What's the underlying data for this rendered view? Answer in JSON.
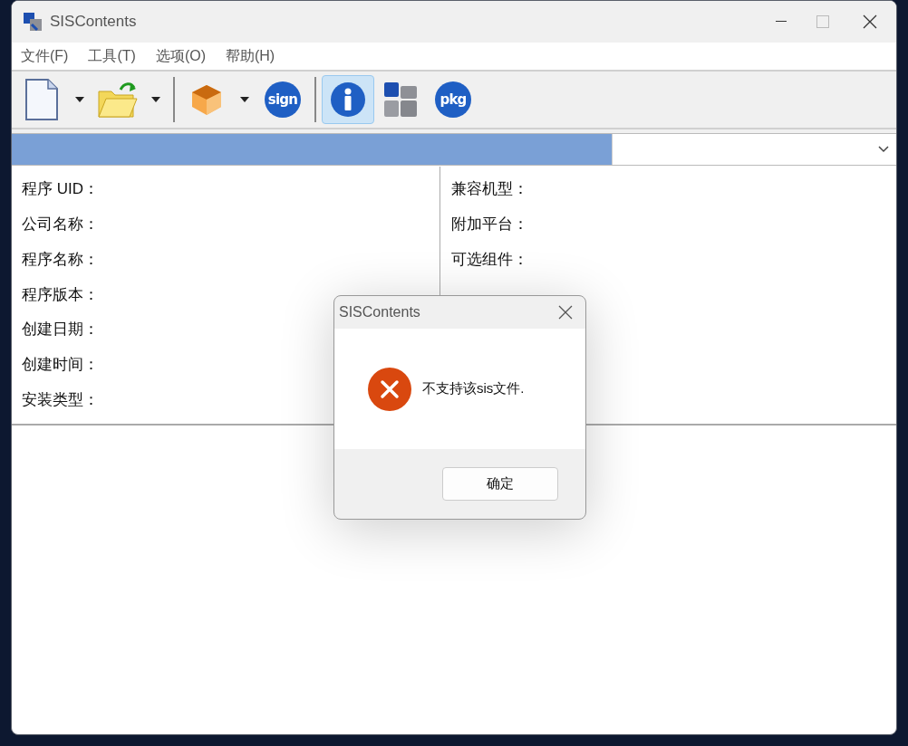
{
  "window": {
    "title": "SISContents"
  },
  "menu": [
    {
      "label": "文件(F)"
    },
    {
      "label": "工具(T)"
    },
    {
      "label": "选项(O)"
    },
    {
      "label": "帮助(H)"
    }
  ],
  "toolbar": [
    {
      "kind": "new",
      "dropdown": true,
      "selected": false
    },
    {
      "kind": "open",
      "dropdown": true,
      "selected": false
    },
    {
      "kind": "separator"
    },
    {
      "kind": "box",
      "dropdown": true,
      "selected": false
    },
    {
      "kind": "badge",
      "label": "sign",
      "dropdown": false,
      "selected": false
    },
    {
      "kind": "separator"
    },
    {
      "kind": "info",
      "dropdown": false,
      "selected": true
    },
    {
      "kind": "tiles",
      "dropdown": false,
      "selected": false
    },
    {
      "kind": "badge",
      "label": "pkg",
      "dropdown": false,
      "selected": false
    }
  ],
  "progress": {
    "level": 1
  },
  "info_left": [
    {
      "label": "程序 UID："
    },
    {
      "label": "公司名称："
    },
    {
      "label": "程序名称："
    },
    {
      "label": "程序版本："
    },
    {
      "label": "创建日期："
    },
    {
      "label": "创建时间："
    },
    {
      "label": "安装类型："
    }
  ],
  "info_right": [
    {
      "label": "兼容机型："
    },
    {
      "label": "附加平台："
    },
    {
      "label": "可选组件："
    }
  ],
  "dialog": {
    "title": "SISContents",
    "message": "不支持该sis文件.",
    "button": "确定"
  }
}
